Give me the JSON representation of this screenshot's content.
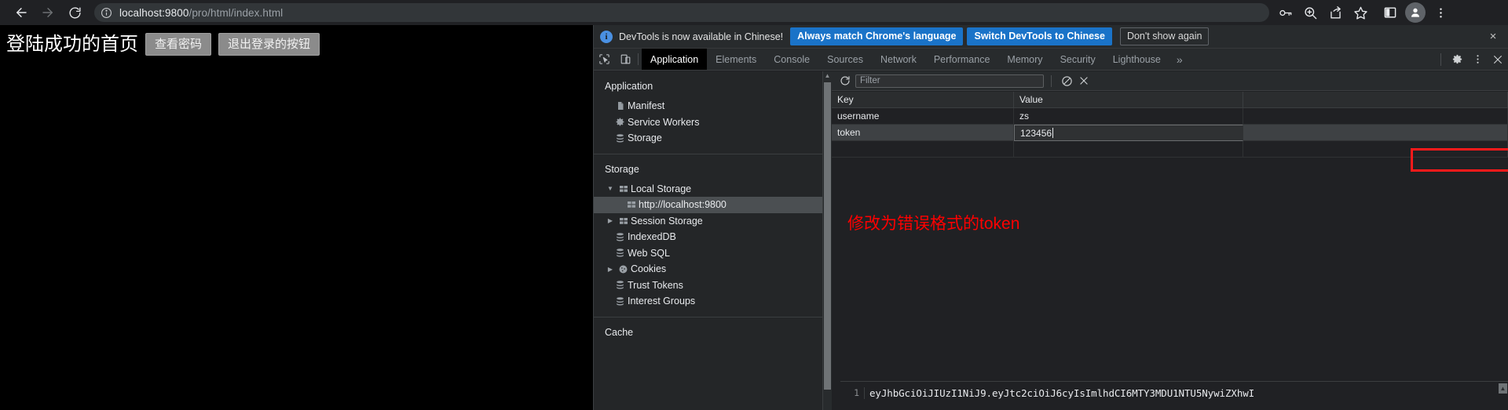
{
  "browser": {
    "nav": {
      "back_label": "Back",
      "forward_label": "Forward",
      "reload_label": "Reload"
    },
    "omnibox": {
      "site_info_icon": "info-circle-icon",
      "host": "localhost:9800",
      "path": "/pro/html/index.html"
    },
    "toolbar_icons": [
      {
        "name": "key-icon",
        "label": "Passwords"
      },
      {
        "name": "zoom-icon",
        "label": "Zoom"
      },
      {
        "name": "share-icon",
        "label": "Share this page"
      },
      {
        "name": "star-icon",
        "label": "Bookmark this tab"
      },
      {
        "name": "side-panel-icon",
        "label": "Side panel"
      },
      {
        "name": "profile-avatar-icon",
        "label": "Profile"
      },
      {
        "name": "more-menu-icon",
        "label": "Customize and control Chrome"
      }
    ]
  },
  "page": {
    "title": "登陆成功的首页",
    "buttons": [
      {
        "label": "查看密码"
      },
      {
        "label": "退出登录的按钮"
      }
    ]
  },
  "devtools": {
    "infobar": {
      "message": "DevTools is now available in Chinese!",
      "primary_button": "Always match Chrome's language",
      "secondary_button": "Switch DevTools to Chinese",
      "dismiss_button": "Don't show again",
      "close_label": "×"
    },
    "tabs": [
      {
        "label": "Application",
        "active": true
      },
      {
        "label": "Elements",
        "active": false
      },
      {
        "label": "Console",
        "active": false
      },
      {
        "label": "Sources",
        "active": false
      },
      {
        "label": "Network",
        "active": false
      },
      {
        "label": "Performance",
        "active": false
      },
      {
        "label": "Memory",
        "active": false
      },
      {
        "label": "Security",
        "active": false
      },
      {
        "label": "Lighthouse",
        "active": false
      }
    ],
    "more_tabs_label": "»",
    "sidebar": {
      "application_section": {
        "title": "Application",
        "items": [
          {
            "label": "Manifest",
            "icon": "document-icon"
          },
          {
            "label": "Service Workers",
            "icon": "gear-icon"
          },
          {
            "label": "Storage",
            "icon": "database-icon"
          }
        ]
      },
      "storage_section": {
        "title": "Storage",
        "items": [
          {
            "label": "Local Storage",
            "icon": "table-icon",
            "arrow": "▼",
            "indent": 0,
            "selected": false
          },
          {
            "label": "http://localhost:9800",
            "icon": "table-icon",
            "arrow": "",
            "indent": 1,
            "selected": true
          },
          {
            "label": "Session Storage",
            "icon": "table-icon",
            "arrow": "▶",
            "indent": 0,
            "selected": false
          },
          {
            "label": "IndexedDB",
            "icon": "database-icon",
            "arrow": "",
            "indent": 0,
            "selected": false
          },
          {
            "label": "Web SQL",
            "icon": "database-icon",
            "arrow": "",
            "indent": 0,
            "selected": false
          },
          {
            "label": "Cookies",
            "icon": "cookie-icon",
            "arrow": "▶",
            "indent": 0,
            "selected": false
          },
          {
            "label": "Trust Tokens",
            "icon": "database-icon",
            "arrow": "",
            "indent": 0,
            "selected": false
          },
          {
            "label": "Interest Groups",
            "icon": "database-icon",
            "arrow": "",
            "indent": 0,
            "selected": false
          }
        ]
      },
      "cache_section": {
        "title": "Cache"
      }
    },
    "storage_pane": {
      "refresh_icon": "refresh-icon",
      "filter_placeholder": "Filter",
      "clear_all_icon": "clear-all-icon",
      "delete_selected_icon": "delete-icon",
      "columns": [
        "Key",
        "Value"
      ],
      "rows": [
        {
          "key": "username",
          "value": "zs",
          "selected": false,
          "editing": false
        },
        {
          "key": "token",
          "value": "123456",
          "selected": true,
          "editing": true
        }
      ]
    },
    "annotation": {
      "text": "修改为错误格式的token",
      "color": "#ff0000",
      "highlight_box_color": "#ff1a1a"
    },
    "preview": {
      "line_number": "1",
      "content": "eyJhbGciOiJIUzI1NiJ9.eyJtc2ciOiJ6cyIsImlhdCI6MTY3MDU1NTU5NywiZXhwI"
    }
  }
}
